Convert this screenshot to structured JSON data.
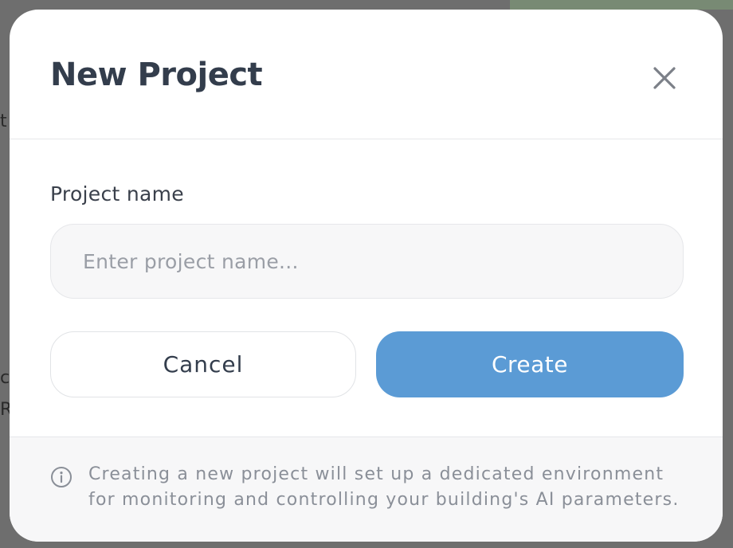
{
  "backdrop": {
    "fragment_1": "t",
    "fragment_2": "c",
    "fragment_3": "R"
  },
  "dialog": {
    "title": "New Project",
    "close_icon": "close-icon",
    "field": {
      "label": "Project name",
      "value": "",
      "placeholder": "Enter project name..."
    },
    "buttons": {
      "cancel_label": "Cancel",
      "create_label": "Create"
    },
    "footer": {
      "info_icon": "info-icon",
      "info_line_1": "Creating a new project will set up a dedicated environment",
      "info_line_2": "for monitoring and controlling your building's AI parameters."
    }
  },
  "colors": {
    "primary": "#5b9bd5",
    "title": "#333d4c",
    "muted_text": "#8a8f98",
    "overlay": "#6e6e6e"
  }
}
